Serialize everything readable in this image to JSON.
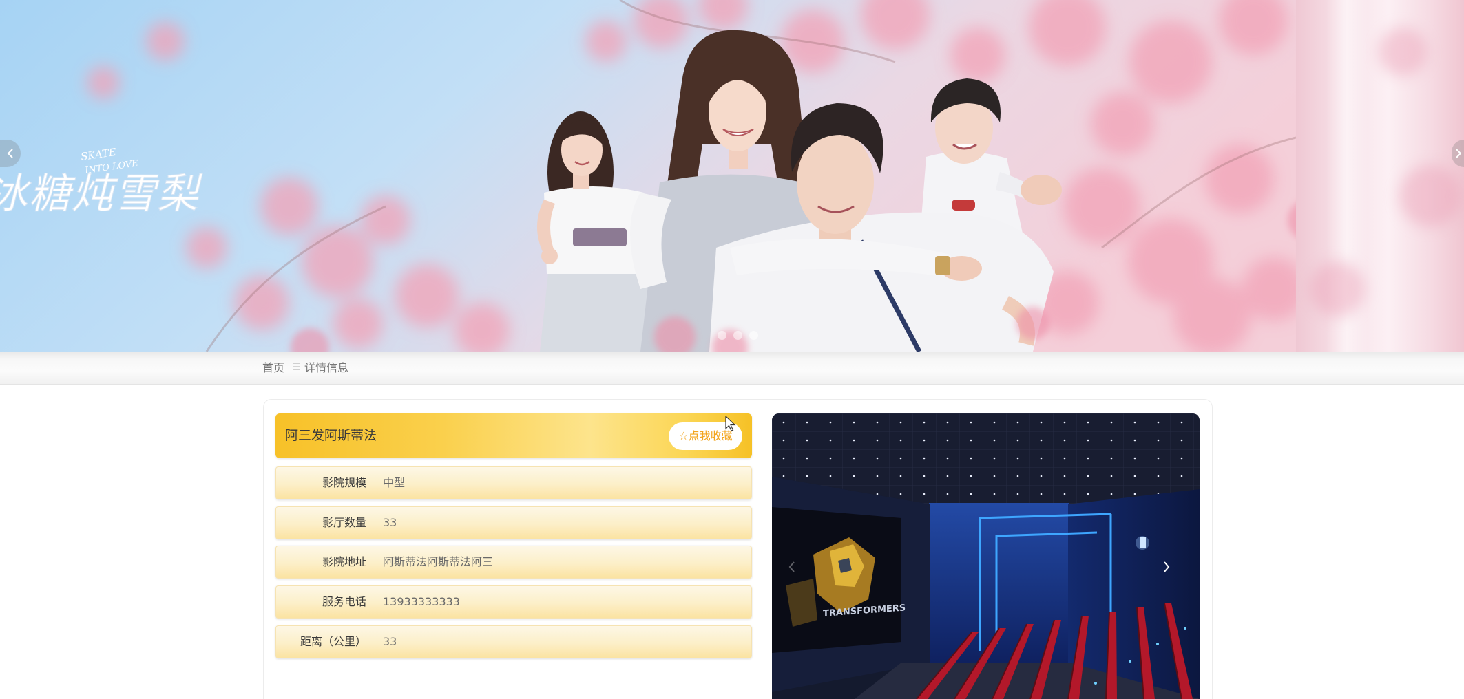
{
  "banner": {
    "title_cn": "冰糖炖雪梨",
    "title_en_line1": "SKATE",
    "title_en_line2": "INTO LOVE",
    "prev_icon": "chevron-left-icon",
    "next_icon": "chevron-right-icon",
    "indicator_count": 3
  },
  "breadcrumb": {
    "home": "首页",
    "separator": "☰",
    "current": "详情信息"
  },
  "cinema": {
    "name": "阿三发阿斯蒂法",
    "favorite_label": "☆点我收藏",
    "fields": [
      {
        "label": "影院规模",
        "value": "中型"
      },
      {
        "label": "影厅数量",
        "value": "33"
      },
      {
        "label": "影院地址",
        "value": "阿斯蒂法阿斯蒂法阿三"
      },
      {
        "label": "服务电话",
        "value": "13933333333"
      },
      {
        "label": "距离（公里）",
        "value": "33"
      }
    ]
  },
  "gallery": {
    "poster_text": "TRANSFORMERS",
    "prev_icon": "chevron-left-icon",
    "next_icon": "chevron-right-icon"
  },
  "colors": {
    "title_bar": "#f9c623",
    "favorite_text": "#f3a51d",
    "row_background": "#fcefc8",
    "breadcrumb_text": "#777777"
  }
}
